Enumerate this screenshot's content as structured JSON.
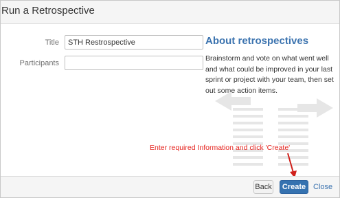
{
  "dialog": {
    "title": "Run a Retrospective"
  },
  "form": {
    "title_label": "Title",
    "title_value": "STH Restrospective",
    "participants_label": "Participants",
    "participants_value": ""
  },
  "about": {
    "heading": "About retrospectives",
    "description": "Brainstorm and vote on what went well and what could be improved in your last sprint or project with your team, then set out some action items."
  },
  "annotation": {
    "text": "Enter required Information and click 'Create'",
    "color": "#e5221d"
  },
  "footer": {
    "back_label": "Back",
    "create_label": "Create",
    "close_label": "Close"
  },
  "colors": {
    "primary": "#3572b0",
    "link": "#3b73af",
    "illustration": "#e6e6e6"
  }
}
